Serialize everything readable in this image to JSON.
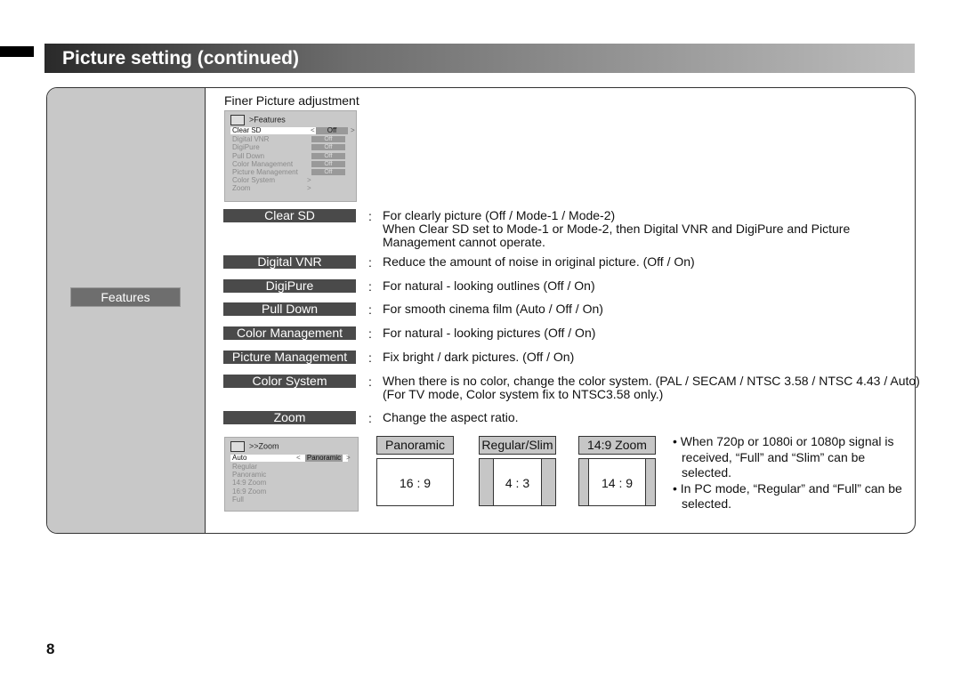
{
  "header": {
    "title": "Picture setting (continued)"
  },
  "side": {
    "label": "Features"
  },
  "section_title": "Finer Picture adjustment",
  "features_osd": {
    "title": ">Features",
    "rows": [
      {
        "name": "Clear SD",
        "value": "Off",
        "selected": true
      },
      {
        "name": "Digital VNR",
        "value": "Off"
      },
      {
        "name": "DigiPure",
        "value": "Off"
      },
      {
        "name": "Pull Down",
        "value": "Off"
      },
      {
        "name": "Color Management",
        "value": "Off"
      },
      {
        "name": "Picture Management",
        "value": "Off"
      },
      {
        "name": "Color System",
        "value": ">"
      },
      {
        "name": "Zoom",
        "value": ">"
      }
    ]
  },
  "items": [
    {
      "label": "Clear SD",
      "desc": [
        "For clearly picture (Off / Mode-1 / Mode-2)",
        "When Clear SD set to Mode-1 or Mode-2, then Digital VNR and DigiPure and Picture",
        "Management cannot operate."
      ]
    },
    {
      "label": "Digital VNR",
      "desc": [
        "Reduce the amount of noise in original picture. (Off / On)"
      ]
    },
    {
      "label": "DigiPure",
      "desc": [
        "For natural - looking outlines (Off / On)"
      ]
    },
    {
      "label": "Pull Down",
      "desc": [
        "For smooth cinema film (Auto / Off / On)"
      ]
    },
    {
      "label": "Color Management",
      "desc": [
        "For natural - looking pictures (Off / On)"
      ]
    },
    {
      "label": "Picture Management",
      "desc": [
        "Fix bright / dark pictures. (Off / On)"
      ]
    },
    {
      "label": "Color System",
      "desc": [
        "When there is no color, change the color system. (PAL / SECAM / NTSC 3.58 / NTSC 4.43 / Auto)",
        "(For TV mode, Color system fix to NTSC3.58 only.)"
      ]
    },
    {
      "label": "Zoom",
      "desc": [
        "Change the aspect ratio."
      ]
    }
  ],
  "colon": ":",
  "zoom_osd": {
    "title": ">>Zoom",
    "selected": "Auto",
    "selected_value": "Panoramic",
    "rows": [
      "Regular",
      "Panoramic",
      "14:9 Zoom",
      "16:9 Zoom",
      "Full"
    ],
    "left_arrow": "<",
    "right_arrow": ">"
  },
  "aspects": [
    {
      "label": "Panoramic",
      "ratio": "16 : 9"
    },
    {
      "label": "Regular/Slim",
      "ratio": "4 : 3"
    },
    {
      "label": "14:9 Zoom",
      "ratio": "14 : 9"
    }
  ],
  "notes": [
    "When 720p or 1080i or 1080p signal is received, “Full” and “Slim” can be selected.",
    "In PC mode, “Regular” and “Full” can be selected."
  ],
  "page_number": "8"
}
